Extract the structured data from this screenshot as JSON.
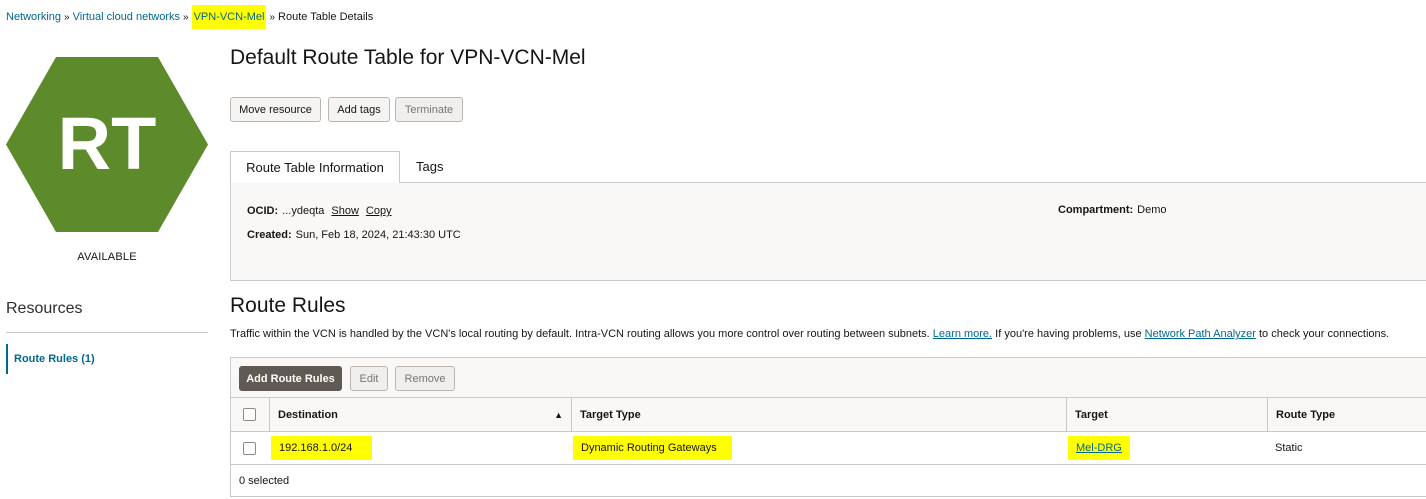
{
  "breadcrumb": {
    "networking": "Networking",
    "vcns": "Virtual cloud networks",
    "vcn": "VPN-VCN-Mel",
    "current": "Route Table Details",
    "sep": "»"
  },
  "badge": {
    "text": "RT",
    "color": "#5d8a2a",
    "status": "AVAILABLE"
  },
  "resources": {
    "title": "Resources",
    "items": [
      {
        "label": "Route Rules (1)"
      }
    ]
  },
  "page": {
    "title": "Default Route Table for VPN-VCN-Mel"
  },
  "actions": {
    "move": "Move resource",
    "add_tags": "Add tags",
    "terminate": "Terminate"
  },
  "tabs": {
    "info": "Route Table Information",
    "tags": "Tags"
  },
  "info": {
    "ocid_label": "OCID:",
    "ocid_value": "...ydeqta",
    "show": "Show",
    "copy": "Copy",
    "created_label": "Created:",
    "created_value": "Sun, Feb 18, 2024, 21:43:30 UTC",
    "compartment_label": "Compartment:",
    "compartment_value": "Demo"
  },
  "rules": {
    "title": "Route Rules",
    "desc_part1": "Traffic within the VCN is handled by the VCN's local routing by default. Intra-VCN routing allows you more control over routing between subnets.",
    "learn_more": "Learn more.",
    "desc_part2": "If you're having problems, use",
    "analyzer": "Network Path Analyzer",
    "desc_part3": "to check your connections.",
    "add_button": "Add Route Rules",
    "edit_button": "Edit",
    "remove_button": "Remove",
    "columns": {
      "destination": "Destination",
      "target_type": "Target Type",
      "target": "Target",
      "route_type": "Route Type"
    },
    "rows": [
      {
        "destination": "192.168.1.0/24",
        "target_type": "Dynamic Routing Gateways",
        "target": "Mel-DRG",
        "route_type": "Static"
      }
    ],
    "selected": "0 selected"
  },
  "colors": {
    "link": "#00688c",
    "highlight": "#ffff00",
    "badge": "#5d8a2a"
  }
}
